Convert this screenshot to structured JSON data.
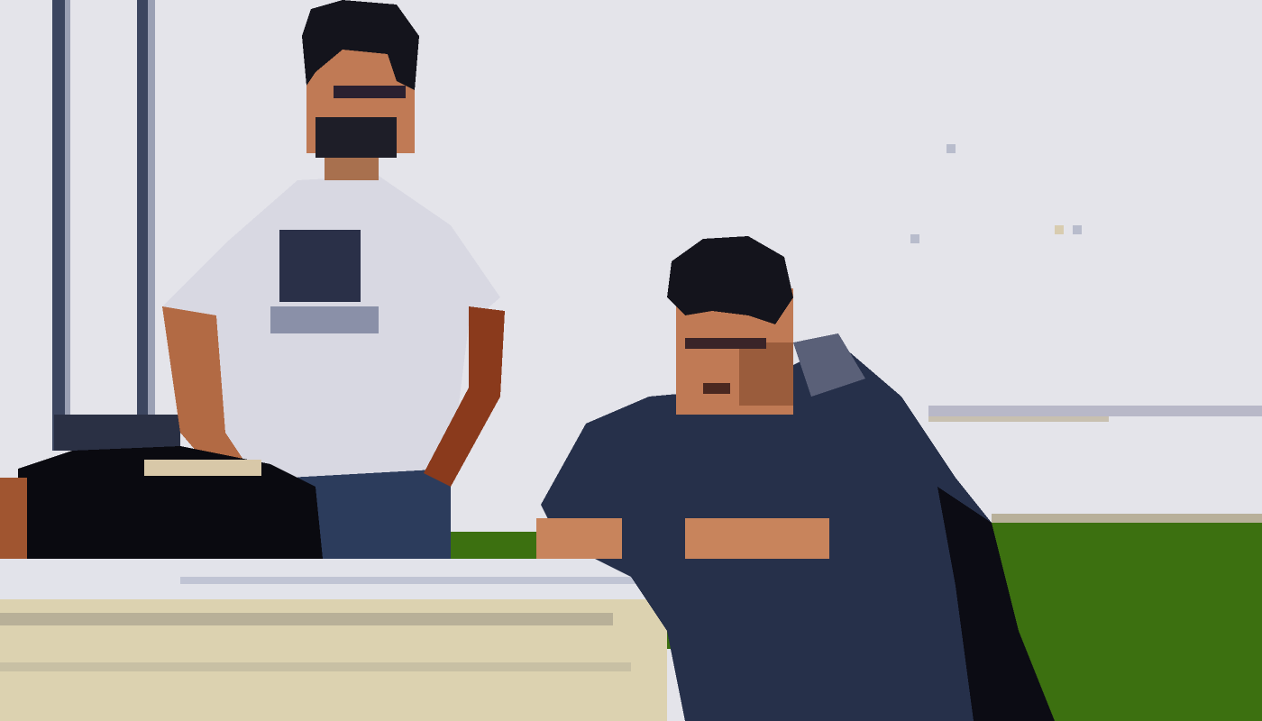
{
  "image": {
    "kind": "pixelated photograph",
    "subjects": [
      "standing-man",
      "seated-man"
    ],
    "colors": {
      "wall": "#e4e4ea",
      "green_panel": "#3c7010",
      "table_top": "#e2e3ea",
      "table_front": "#dcd2b0",
      "skin": "#c07a55",
      "hair": "#14141c",
      "white_shirt": "#d8d8e2",
      "dark_jacket": "#26304a",
      "jeans": "#2c3c5c",
      "black_bag": "#0a0a10",
      "pole": "#3c4660"
    }
  }
}
